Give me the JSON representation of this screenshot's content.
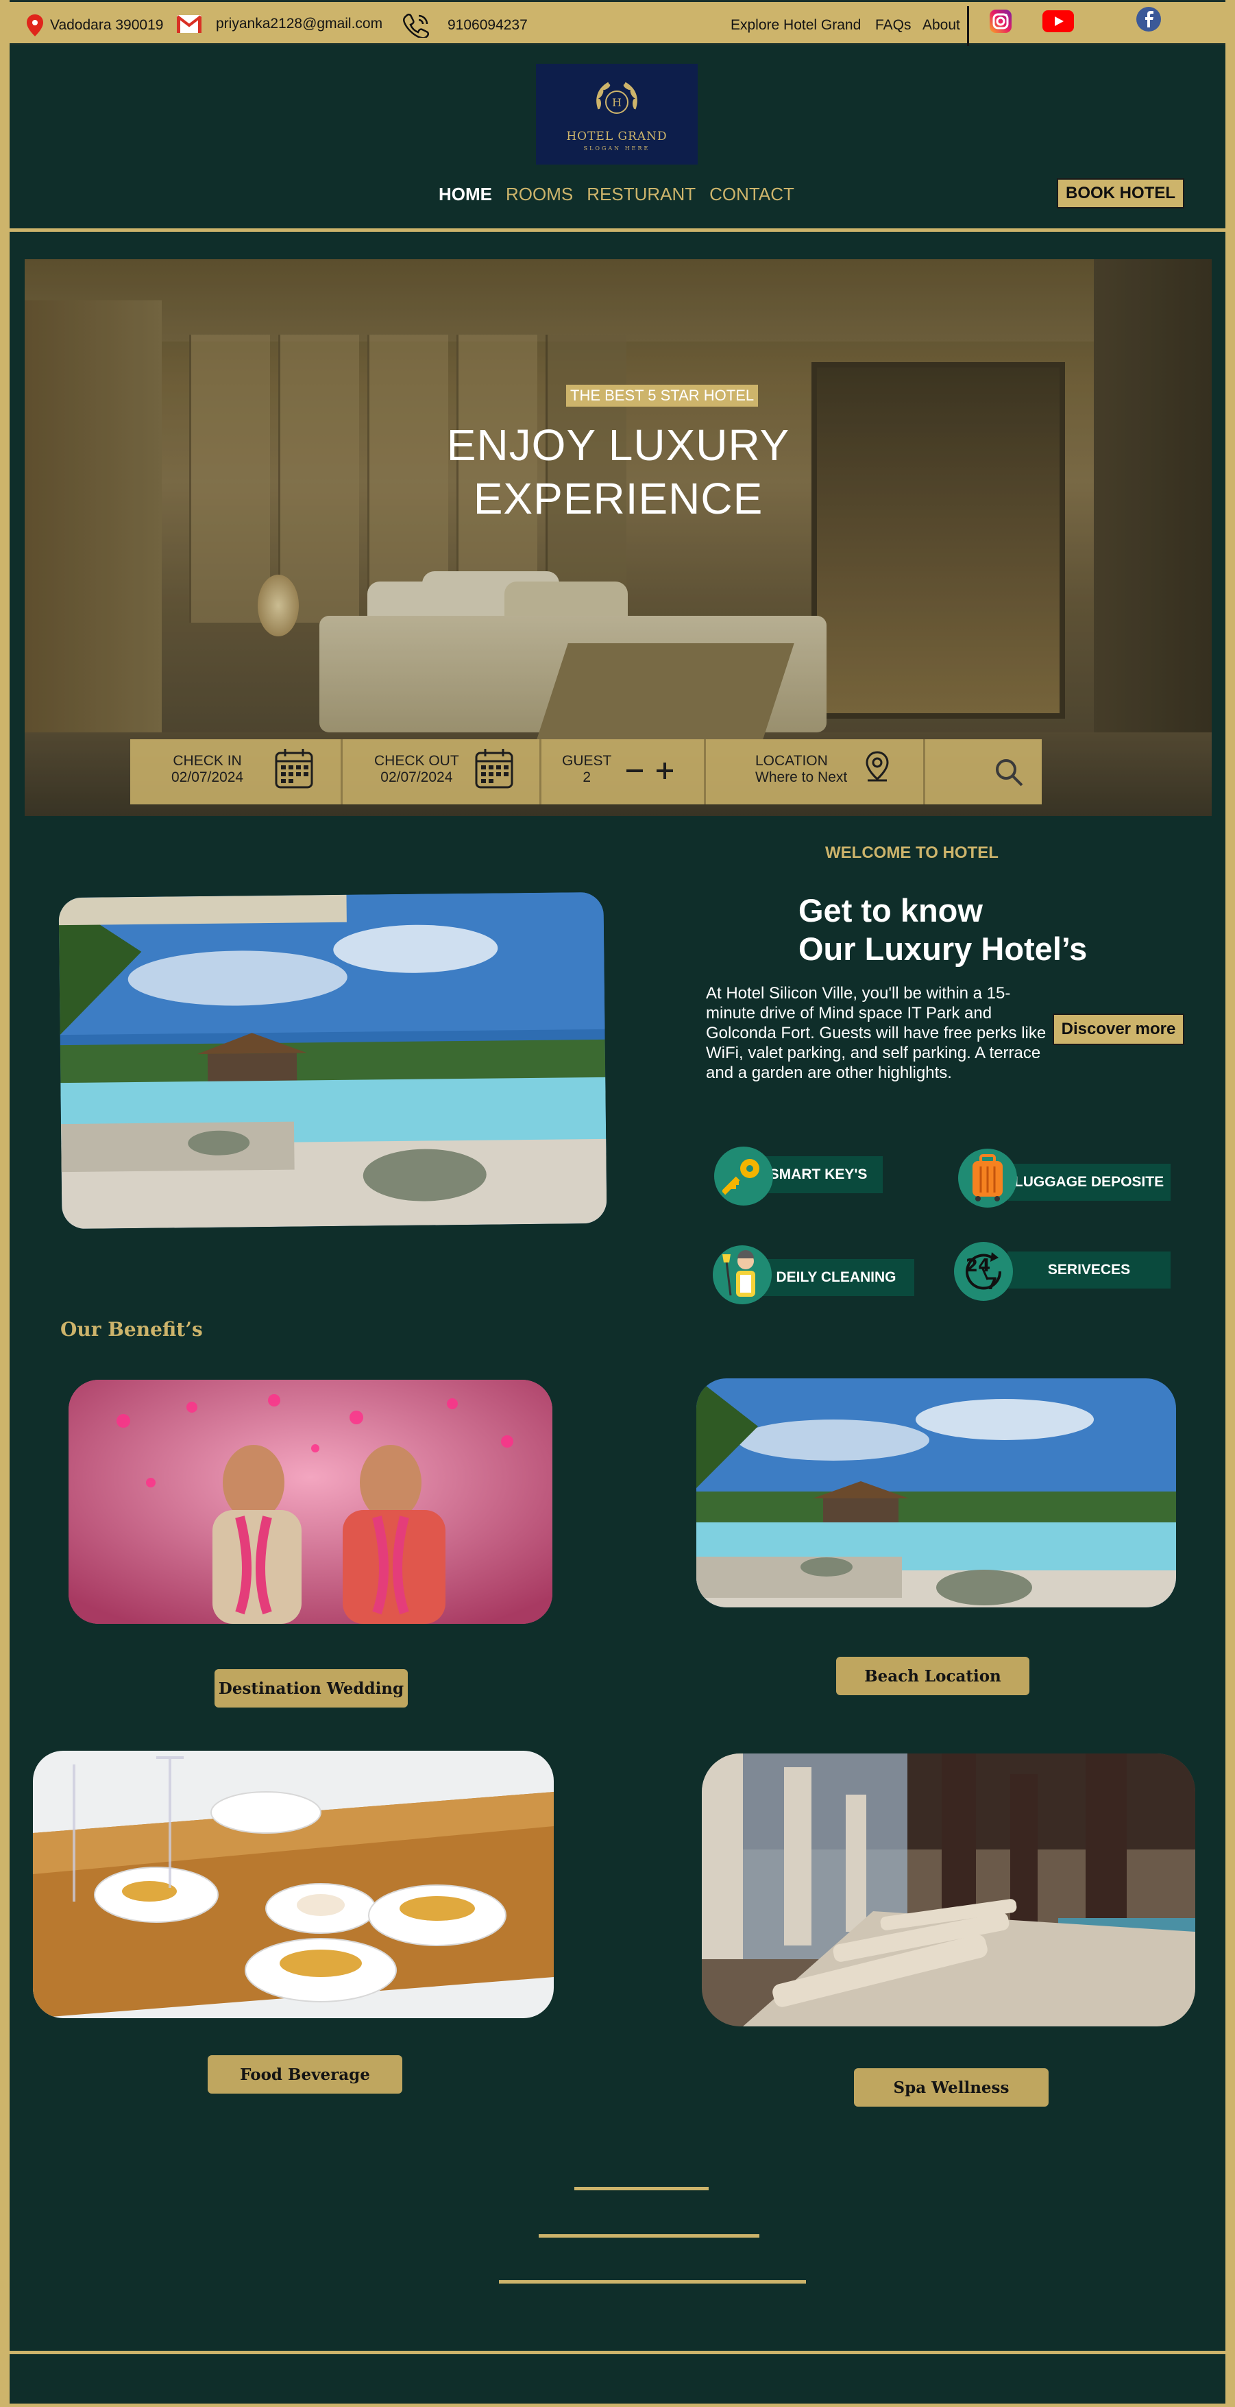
{
  "topbar": {
    "location": "Vadodara 390019",
    "email": "priyanka2128@gmail.com",
    "phone": "9106094237",
    "links": [
      "Explore Hotel Grand",
      "FAQs",
      "About"
    ]
  },
  "brand": {
    "name": "HOTEL GRAND",
    "slogan": "SLOGAN HERE",
    "monogram": "H"
  },
  "nav": {
    "items": [
      "HOME",
      "ROOMS",
      "RESTURANT",
      "CONTACT"
    ],
    "active": "HOME",
    "book_label": "BOOK HOTEL"
  },
  "hero": {
    "tagline": "THE BEST 5 STAR HOTEL",
    "title_line1": "ENJOY LUXURY",
    "title_line2": "EXPERIENCE",
    "search": {
      "checkin_label": "CHECK IN",
      "checkin_value": "02/07/2024",
      "checkout_label": "CHECK OUT",
      "checkout_value": "02/07/2024",
      "guest_label": "GUEST",
      "guest_value": "2",
      "location_label": "LOCATION",
      "location_value": "Where to Next"
    }
  },
  "about": {
    "kicker": "WELCOME TO HOTEL",
    "heading_line1": "Get to know",
    "heading_line2": "Our Luxury Hotel’s",
    "paragraph": "At Hotel Silicon Ville, you'll be within a 15-minute drive of Mind space IT Park and Golconda Fort. Guests will have free perks like WiFi, valet parking, and self parking. A terrace and a garden are other highlights.",
    "discover_label": "Discover more",
    "features": [
      "SMART KEY'S",
      "LUGGAGE DEPOSITE",
      "DEILY CLEANING",
      "SERIVECES"
    ]
  },
  "benefits": {
    "heading": "Our Benefit’s",
    "items": [
      "Destination  Wedding",
      "Beach Location",
      "Food Beverage",
      "Spa  Wellness"
    ]
  },
  "colors": {
    "background": "#0f2e2a",
    "gold": "#cdb46b",
    "feature": "#0a4a3d",
    "icon_circle": "#1f8b73"
  },
  "icons": [
    "location-pin-icon",
    "gmail-icon",
    "phone-icon",
    "instagram-icon",
    "youtube-icon",
    "facebook-icon",
    "calendar-icon",
    "minus-icon",
    "plus-icon",
    "map-pin-icon",
    "search-icon",
    "key-icon",
    "luggage-icon",
    "cleaner-icon",
    "24-7-icon"
  ]
}
